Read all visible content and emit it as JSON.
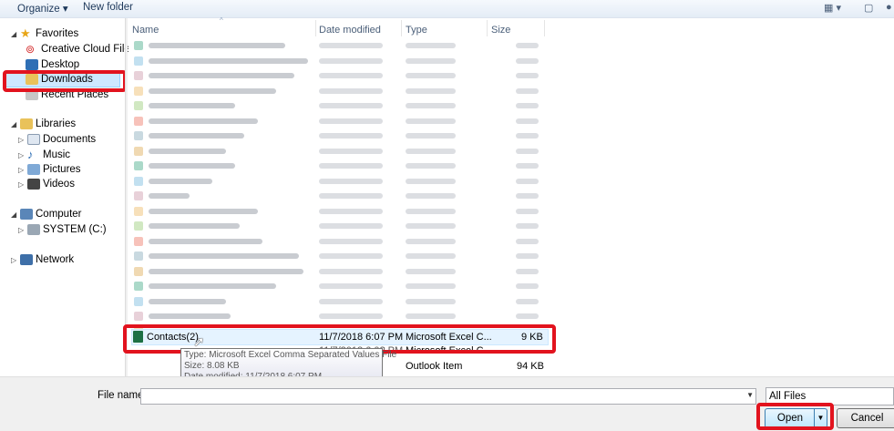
{
  "toolbar": {
    "organize": "Organize ▾",
    "new_folder": "New folder",
    "views": "▦ ▾",
    "preview": "▢",
    "help": "●"
  },
  "nav": {
    "favorites": "Favorites",
    "creative_cloud": "Creative Cloud Files",
    "desktop": "Desktop",
    "downloads": "Downloads",
    "recent_places": "Recent Places",
    "libraries": "Libraries",
    "documents": "Documents",
    "music": "Music",
    "pictures": "Pictures",
    "videos": "Videos",
    "computer": "Computer",
    "system_c": "SYSTEM (C:)",
    "network": "Network"
  },
  "columns": {
    "name": "Name",
    "date_modified": "Date modified",
    "type": "Type",
    "size": "Size"
  },
  "files": {
    "contacts": {
      "name": "Contacts(2)",
      "date": "11/7/2018 6:07 PM",
      "type": "Microsoft Excel C...",
      "size": "9 KB"
    },
    "partial_row_1": {
      "date": "11/7/2018 6:0? PM",
      "type": "Microsoft Excel C..."
    },
    "partial_row_2": {
      "type": "Outlook Item",
      "size": "94 KB"
    }
  },
  "tooltip": {
    "type": "Type: Microsoft Excel Comma Separated Values File",
    "size": "Size: 8.08 KB",
    "date": "Date modified: 11/7/2018 6:07 PM"
  },
  "bottom": {
    "file_name_label": "File name:",
    "file_name_value": "",
    "file_type": "All Files",
    "open": "Open",
    "cancel": "Cancel"
  },
  "colors": {
    "highlight": "#e2131e",
    "selection": "#cde8ff",
    "excel_green": "#1d7044"
  }
}
